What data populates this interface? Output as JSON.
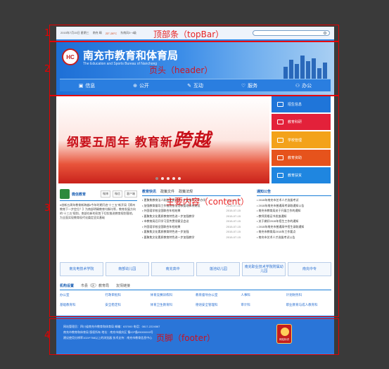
{
  "annotations": {
    "regions": [
      {
        "num": "1",
        "label": "顶部条（topBar）"
      },
      {
        "num": "2",
        "label": "页头（header）"
      },
      {
        "num": "3",
        "label": "主要内容（content）"
      },
      {
        "num": "4",
        "label": "页脚（footer）"
      }
    ]
  },
  "topbar": {
    "date": "2015年7月15日 星期三",
    "city": "南充 晴",
    "temp": "23°-28°C",
    "wind": "东南风3~4级",
    "search_placeholder": ""
  },
  "header": {
    "logo_text": "HC",
    "title": "南充市教育和体育局",
    "subtitle": "The Education and Sports Bureau of Nanchong",
    "nav": [
      {
        "label": "信息",
        "icon": "info-icon"
      },
      {
        "label": "公开",
        "icon": "share-icon"
      },
      {
        "label": "互动",
        "icon": "chat-icon"
      },
      {
        "label": "服务",
        "icon": "heart-icon"
      },
      {
        "label": "办公",
        "icon": "user-icon"
      }
    ]
  },
  "content": {
    "banner": {
      "slogan_prefix": "纲要五周年 教育新",
      "slogan_emph": "跨越"
    },
    "quick_links": [
      {
        "label": "招生信息",
        "color": "#1f75d9"
      },
      {
        "label": "教育科研",
        "color": "#e3213a"
      },
      {
        "label": "学校管理",
        "color": "#f3a21a"
      },
      {
        "label": "教育资助",
        "color": "#e6531c"
      },
      {
        "label": "教育扶贫",
        "color": "#1f86e0"
      }
    ],
    "weibo": {
      "title": "微信教育",
      "tabs": [
        "微博",
        "微信",
        "客户端"
      ],
      "text": "#创新五周年教育新跨越#今年时期开启“十三五”新开局【郑州教育下一步定位？】为南部明确教育均衡均等，教育发展方向的“十三五”规划，南部在新的形势下切实推进教育规划落地，为全面实现教育现代化奠定坚实基础"
    },
    "news": {
      "tabs": [
        "教育快讯",
        "政策文件",
        "政策法规"
      ],
      "items": [
        {
          "text": "• 更聚焦教育法人制度化建设进一步加强中小学办学",
          "date": "2015-07-15"
        },
        {
          "text": "• 加强教育督导工作推进依法治教管理体系建设",
          "date": "2015-07-15"
        },
        {
          "text": "• 外国语学校全国联合年检结果",
          "date": "2015-07-15"
        },
        {
          "text": "• 要聚焦文化素质教育特色进一步加强教学",
          "date": "2015-07-15"
        },
        {
          "text": "• 市教育局召开学习宣传贯彻意见会议",
          "date": "2015-07-15"
        },
        {
          "text": "• 外国语学校全国联合年检结果",
          "date": "2015-07-15"
        },
        {
          "text": "• 要聚焦文化素质教育特色进一步加强",
          "date": "2015-07-15"
        },
        {
          "text": "• 要聚焦文化素质教育特色进一步加强教学",
          "date": "2015-07-15"
        }
      ]
    },
    "notices": {
      "title": "通知公告",
      "items": [
        "• 2015年南充市艺术人才选拔考试",
        "• 2015年南充市普通高考录取通知公告",
        "• 南充市教育局关于开展工作的通知",
        "• 教师资格证书发放通知",
        "• 关于做好2015年招生工作的通知",
        "• 2015年南充市普通高中招生录取通知",
        "• 南充市教育局2015年工作要点",
        "• 南充市艺术人才选拔考试公告"
      ]
    },
    "units": [
      "南充电技术学院",
      "南部幼儿园",
      "南充高中",
      "莲池幼儿园",
      "南充职业技术学院附属幼儿园",
      "南充中专"
    ],
    "links": {
      "tabs": [
        "机构设置",
        "市县（区）教育局",
        "友情链接"
      ],
      "items": [
        "办公室",
        "行政审批科",
        "体育竞赛训练科",
        "教育督导办公室",
        "人事科",
        "计划财务科",
        "基础教育科",
        "安全稳定科",
        "体育卫生教育科",
        "德语安全管理科",
        "审计科",
        "职业教育与成人教育科"
      ]
    }
  },
  "footer": {
    "lines": [
      "网站管理员：四川省南充市教育和体育局  邮编：637000  电话：0817-2224567",
      "南充市教育和体育局 版权所有  地址：南充市顺庆区  蜀ICP备05000000号",
      "建议使用分辨率1024*768以上的浏览器  技术支持：南充市教育信息中心"
    ],
    "badge_text": "网站标识"
  }
}
